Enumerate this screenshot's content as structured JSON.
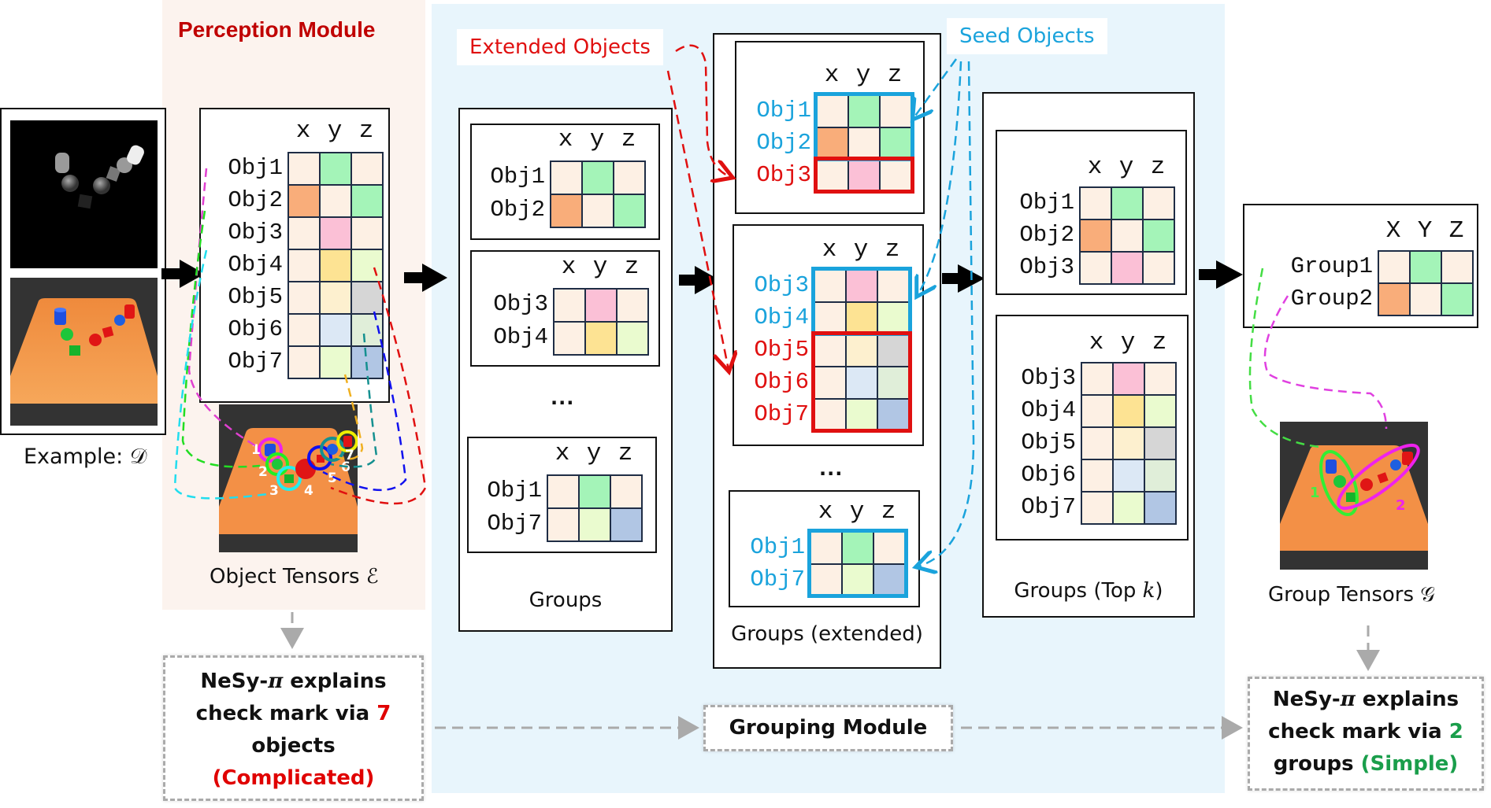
{
  "colors": {
    "beige": "#fdf0e4",
    "green": "#a4f4b8",
    "orange": "#f9ad7a",
    "pink": "#fbc0d6",
    "yellow": "#fde393",
    "lightyellow": "#fdf0cf",
    "lime": "#eafbcf",
    "gray": "#d6d6d6",
    "lightblue": "#dce8f5",
    "palegreen": "#e0eed9",
    "blue": "#b1c6e4",
    "seed": "#1aa3dc",
    "extended": "#e01010",
    "perception_title": "#c00000",
    "simple_green": "#1a9e4b",
    "complicated_red": "#e00000"
  },
  "perception": {
    "title": "Perception Module",
    "example_label": "Example: 𝒟",
    "tensor_caption": "Object Tensors ℰ",
    "tensor": {
      "header": [
        "x",
        "y",
        "z"
      ],
      "rows": [
        {
          "label": "Obj1",
          "cells": [
            "beige",
            "green",
            "beige"
          ]
        },
        {
          "label": "Obj2",
          "cells": [
            "orange",
            "beige",
            "green"
          ]
        },
        {
          "label": "Obj3",
          "cells": [
            "beige",
            "pink",
            "beige"
          ]
        },
        {
          "label": "Obj4",
          "cells": [
            "beige",
            "yellow",
            "lime"
          ]
        },
        {
          "label": "Obj5",
          "cells": [
            "beige",
            "lightyellow",
            "gray"
          ]
        },
        {
          "label": "Obj6",
          "cells": [
            "beige",
            "lightblue",
            "palegreen"
          ]
        },
        {
          "label": "Obj7",
          "cells": [
            "beige",
            "lime",
            "blue"
          ]
        }
      ]
    },
    "object_numbers": [
      "1",
      "2",
      "3",
      "4",
      "5",
      "6",
      "7"
    ],
    "explain_box": {
      "line1_a": "NeSy-",
      "line1_pi": "π",
      "line1_b": " explains",
      "line2_a": "check mark via ",
      "line2_num": "7",
      "line3": "objects",
      "line4": "(Complicated)"
    }
  },
  "grouping": {
    "extended_tag": "Extended Objects",
    "seed_tag": "Seed Objects",
    "module_label": "Grouping Module",
    "groups": {
      "caption": "Groups",
      "ellipsis": "...",
      "items": [
        {
          "header": [
            "x",
            "y",
            "z"
          ],
          "rows": [
            {
              "label": "Obj1",
              "cells": [
                "beige",
                "green",
                "beige"
              ]
            },
            {
              "label": "Obj2",
              "cells": [
                "orange",
                "beige",
                "green"
              ]
            }
          ]
        },
        {
          "header": [
            "x",
            "y",
            "z"
          ],
          "rows": [
            {
              "label": "Obj3",
              "cells": [
                "beige",
                "pink",
                "beige"
              ]
            },
            {
              "label": "Obj4",
              "cells": [
                "beige",
                "yellow",
                "lime"
              ]
            }
          ]
        },
        {
          "header": [
            "x",
            "y",
            "z"
          ],
          "rows": [
            {
              "label": "Obj1",
              "cells": [
                "beige",
                "green",
                "beige"
              ]
            },
            {
              "label": "Obj7",
              "cells": [
                "beige",
                "lime",
                "blue"
              ]
            }
          ]
        }
      ]
    },
    "extended": {
      "caption": "Groups (extended)",
      "ellipsis": "...",
      "items": [
        {
          "header": [
            "x",
            "y",
            "z"
          ],
          "rows": [
            {
              "label": "Obj1",
              "role": "seed",
              "cells": [
                "beige",
                "green",
                "beige"
              ]
            },
            {
              "label": "Obj2",
              "role": "seed",
              "cells": [
                "orange",
                "beige",
                "green"
              ]
            },
            {
              "label": "Obj3",
              "role": "extended",
              "cells": [
                "beige",
                "pink",
                "beige"
              ]
            }
          ]
        },
        {
          "header": [
            "x",
            "y",
            "z"
          ],
          "rows": [
            {
              "label": "Obj3",
              "role": "seed",
              "cells": [
                "beige",
                "pink",
                "beige"
              ]
            },
            {
              "label": "Obj4",
              "role": "seed",
              "cells": [
                "beige",
                "yellow",
                "lime"
              ]
            },
            {
              "label": "Obj5",
              "role": "extended",
              "cells": [
                "beige",
                "lightyellow",
                "gray"
              ]
            },
            {
              "label": "Obj6",
              "role": "extended",
              "cells": [
                "beige",
                "lightblue",
                "palegreen"
              ]
            },
            {
              "label": "Obj7",
              "role": "extended",
              "cells": [
                "beige",
                "lime",
                "blue"
              ]
            }
          ]
        },
        {
          "header": [
            "x",
            "y",
            "z"
          ],
          "rows": [
            {
              "label": "Obj1",
              "role": "seed",
              "cells": [
                "beige",
                "green",
                "beige"
              ]
            },
            {
              "label": "Obj7",
              "role": "seed",
              "cells": [
                "beige",
                "lime",
                "blue"
              ]
            }
          ]
        }
      ]
    },
    "topk": {
      "caption_a": "Groups (Top ",
      "caption_k": "k",
      "caption_b": ")",
      "items": [
        {
          "header": [
            "x",
            "y",
            "z"
          ],
          "rows": [
            {
              "label": "Obj1",
              "cells": [
                "beige",
                "green",
                "beige"
              ]
            },
            {
              "label": "Obj2",
              "cells": [
                "orange",
                "beige",
                "green"
              ]
            },
            {
              "label": "Obj3",
              "cells": [
                "beige",
                "pink",
                "beige"
              ]
            }
          ]
        },
        {
          "header": [
            "x",
            "y",
            "z"
          ],
          "rows": [
            {
              "label": "Obj3",
              "cells": [
                "beige",
                "pink",
                "beige"
              ]
            },
            {
              "label": "Obj4",
              "cells": [
                "beige",
                "yellow",
                "lime"
              ]
            },
            {
              "label": "Obj5",
              "cells": [
                "beige",
                "lightyellow",
                "gray"
              ]
            },
            {
              "label": "Obj6",
              "cells": [
                "beige",
                "lightblue",
                "palegreen"
              ]
            },
            {
              "label": "Obj7",
              "cells": [
                "beige",
                "lime",
                "blue"
              ]
            }
          ]
        }
      ]
    }
  },
  "output": {
    "tensor": {
      "header": [
        "X",
        "Y",
        "Z"
      ],
      "rows": [
        {
          "label": "Group1",
          "cells": [
            "beige",
            "green",
            "beige"
          ]
        },
        {
          "label": "Group2",
          "cells": [
            "orange",
            "beige",
            "green"
          ]
        }
      ]
    },
    "group_numbers": [
      "1",
      "2"
    ],
    "caption": "Group Tensors 𝒢",
    "explain_box": {
      "line1_a": "NeSy-",
      "line1_pi": "π",
      "line1_b": " explains",
      "line2_a": "check mark via ",
      "line2_num": "2",
      "line3_a": "groups ",
      "line3_b": "(Simple)"
    }
  }
}
